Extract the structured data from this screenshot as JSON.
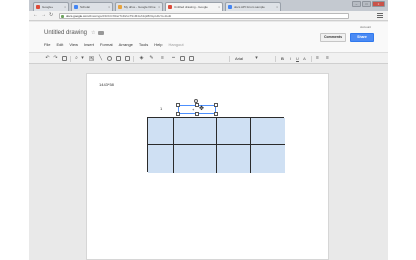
{
  "browser": {
    "tabs": [
      {
        "label": "Google+",
        "color": "#dd4b39",
        "active": false
      },
      {
        "label": "Scholar",
        "color": "#4285f4",
        "active": false
      },
      {
        "label": "My drive - Google Drive",
        "color": "#e8a33d",
        "active": false
      },
      {
        "label": "Untitled drawing - Google",
        "color": "#dd4b39",
        "active": true
      },
      {
        "label": "docs API forum sample",
        "color": "#4285f4",
        "active": false
      }
    ],
    "tab_close_glyph": "×",
    "window_buttons": [
      "–",
      "□",
      "×"
    ],
    "nav_icons": [
      "left-arrow-icon",
      "right-arrow-icon",
      "reload-icon"
    ],
    "url_host": "docs.google.com",
    "url_path": "/drawings/d/1FbCXRaz7kD2xsT9nM4cA3qWb6LpH0vYeJ/edit"
  },
  "doc": {
    "title": "Untitled drawing",
    "star_glyph": "☆",
    "account": "Account",
    "comments_label": "Comments",
    "share_label": "Share",
    "menu": [
      "File",
      "Edit",
      "View",
      "Insert",
      "Format",
      "Arrange",
      "Tools",
      "Help",
      "Hangout"
    ]
  },
  "toolbar": {
    "font": "Arial",
    "icons": [
      "undo-icon",
      "redo-icon",
      "paint-format-icon",
      "zoom-icon",
      "select-icon",
      "line-icon",
      "shape-icon",
      "image-icon",
      "text-box-icon",
      "fill-color-icon",
      "line-color-icon",
      "line-weight-icon",
      "line-dash-icon",
      "bold-icon",
      "italic-icon",
      "underline-icon",
      "text-color-icon",
      "align-icon",
      "more-icon"
    ],
    "glyphs": {
      "undo": "↶",
      "redo": "↷",
      "zoom": "⌕",
      "select": "↖",
      "line": "╲",
      "caret": "▾",
      "bold": "B",
      "italic": "I",
      "underline": "U",
      "text_color": "A",
      "more": "≡"
    }
  },
  "canvas": {
    "page_label": "1443*58",
    "row_number": "1",
    "cursor_label": "+",
    "table": {
      "rows": 2,
      "cols": 4,
      "fill": "#cfe0f3",
      "border": "#2b2b2b"
    }
  },
  "colors": {
    "accent": "#4a8af4",
    "selection": "#4d90fe"
  }
}
